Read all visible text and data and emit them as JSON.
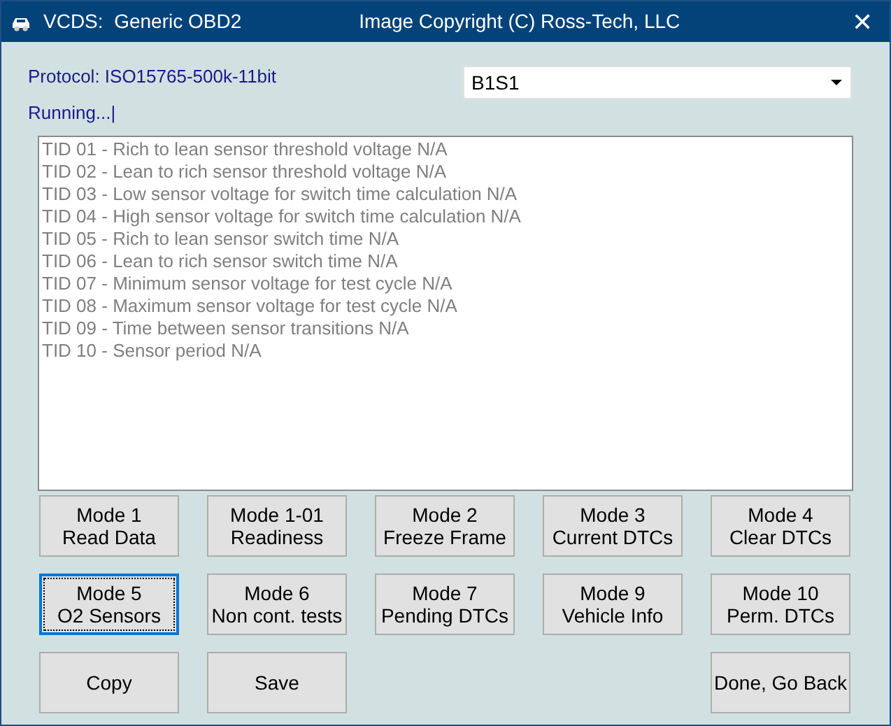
{
  "window": {
    "title": "VCDS:  Generic OBD2",
    "subtitle": "Image Copyright (C) Ross-Tech, LLC",
    "close": "✕"
  },
  "protocol": "Protocol: ISO15765-500k-11bit",
  "status": "Running...|",
  "sensor_select": {
    "value": "B1S1"
  },
  "results": [
    "TID 01 - Rich to lean sensor threshold voltage N/A",
    "TID 02 - Lean to rich sensor threshold voltage N/A",
    "TID 03 - Low sensor voltage for switch time calculation N/A",
    "TID 04 - High sensor voltage for switch time calculation N/A",
    "TID 05 - Rich to lean sensor switch time N/A",
    "TID 06 - Lean to rich sensor switch time N/A",
    "TID 07 - Minimum sensor voltage for test cycle N/A",
    "TID 08 - Maximum sensor voltage for test cycle N/A",
    "TID 09 - Time between sensor transitions N/A",
    "TID 10 - Sensor period N/A"
  ],
  "mode_buttons": [
    {
      "lines": [
        "Mode 1",
        "Read Data"
      ],
      "selected": false
    },
    {
      "lines": [
        "Mode 1-01",
        "Readiness"
      ],
      "selected": false
    },
    {
      "lines": [
        "Mode 2",
        "Freeze Frame"
      ],
      "selected": false
    },
    {
      "lines": [
        "Mode 3",
        "Current DTCs"
      ],
      "selected": false
    },
    {
      "lines": [
        "Mode 4",
        "Clear DTCs"
      ],
      "selected": false
    },
    {
      "lines": [
        "Mode 5",
        "O2 Sensors"
      ],
      "selected": true
    },
    {
      "lines": [
        "Mode 6",
        "Non cont. tests"
      ],
      "selected": false
    },
    {
      "lines": [
        "Mode 7",
        "Pending DTCs"
      ],
      "selected": false
    },
    {
      "lines": [
        "Mode 9",
        "Vehicle Info"
      ],
      "selected": false
    },
    {
      "lines": [
        "Mode 10",
        "Perm. DTCs"
      ],
      "selected": false
    }
  ],
  "action_buttons": [
    {
      "label": "Copy"
    },
    {
      "label": "Save"
    },
    {
      "label": "Done, Go Back"
    }
  ]
}
